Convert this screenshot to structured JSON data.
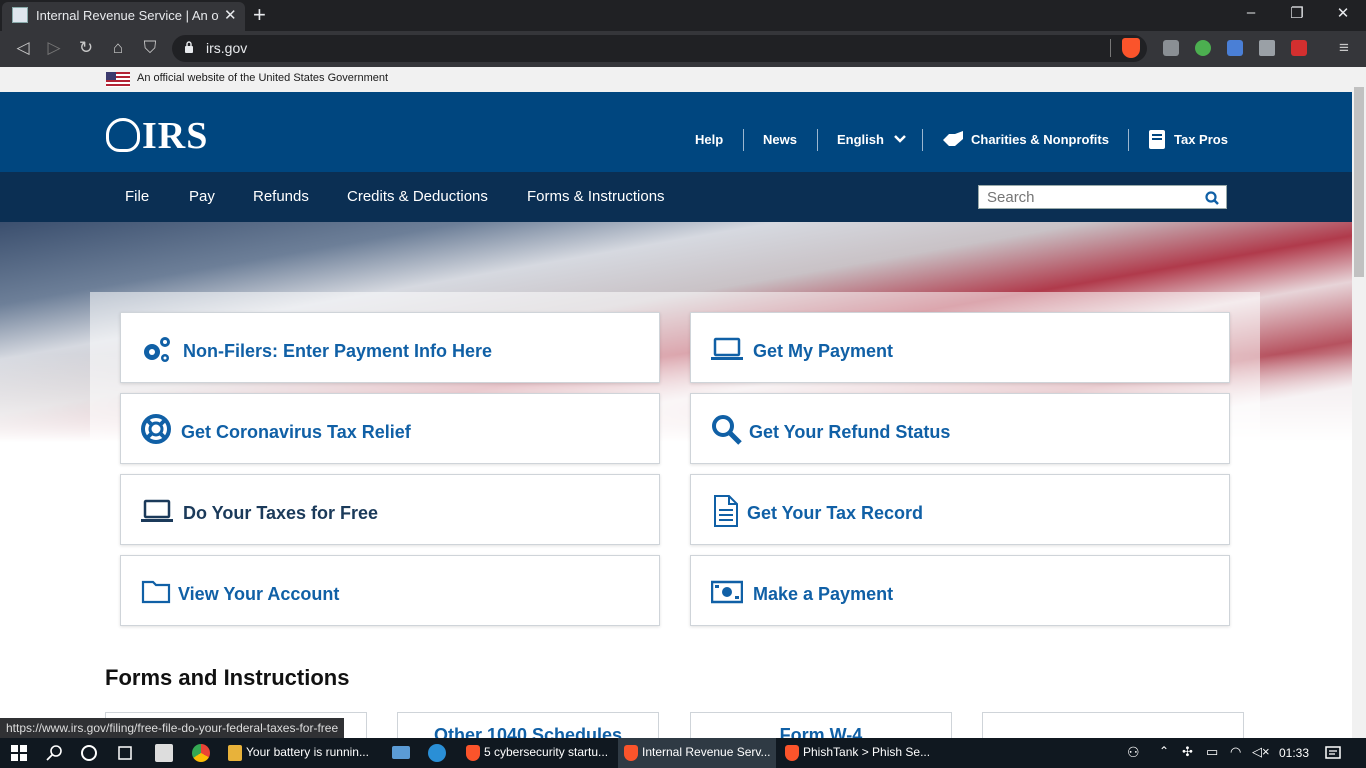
{
  "browser": {
    "tab_title": "Internal Revenue Service | An official",
    "tab_close": "✕",
    "new_tab": "+",
    "url": "irs.gov",
    "status_url": "https://www.irs.gov/filing/free-file-do-your-federal-taxes-for-free"
  },
  "gov_banner": {
    "text": "An official website of the United States Government"
  },
  "header": {
    "logo": "IRS",
    "links": {
      "help": "Help",
      "news": "News",
      "language": "English",
      "charities": "Charities & Nonprofits",
      "tax_pros": "Tax Pros"
    }
  },
  "main_nav": {
    "items": [
      "File",
      "Pay",
      "Refunds",
      "Credits & Deductions",
      "Forms & Instructions"
    ],
    "search_placeholder": "Search"
  },
  "cards": {
    "left": [
      "Non-Filers: Enter Payment Info Here",
      "Get Coronavirus Tax Relief",
      "Do Your Taxes for Free",
      "View Your Account"
    ],
    "right": [
      "Get My Payment",
      "Get Your Refund Status",
      "Get Your Tax Record",
      "Make a Payment"
    ]
  },
  "forms_section": {
    "heading": "Forms and Instructions",
    "cards": [
      "",
      "Other 1040 Schedules",
      "Form W-4",
      ""
    ]
  },
  "taskbar": {
    "apps": [
      "Your battery is runnin...",
      "5 cybersecurity startu...",
      "Internal Revenue Serv...",
      "PhishTank > Phish Se..."
    ],
    "time": "01:33"
  },
  "colors": {
    "header_blue": "#00467f",
    "nav_dark": "#0b2f53",
    "link_blue": "#1060a6"
  }
}
